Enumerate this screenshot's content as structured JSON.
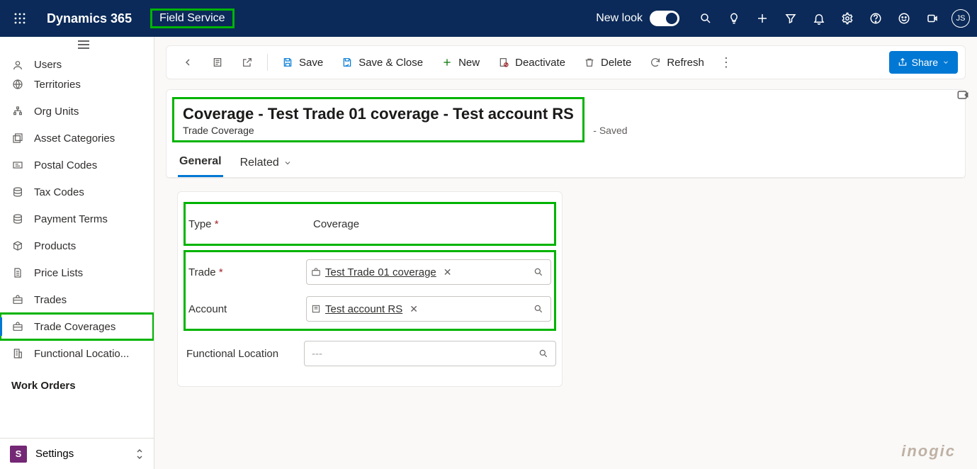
{
  "header": {
    "product": "Dynamics 365",
    "app": "Field Service",
    "newlook_label": "New look",
    "avatar_initials": "JS"
  },
  "sidebar": {
    "items": [
      {
        "label": "Users",
        "icon": "user"
      },
      {
        "label": "Territories",
        "icon": "globe"
      },
      {
        "label": "Org Units",
        "icon": "org"
      },
      {
        "label": "Asset Categories",
        "icon": "asset"
      },
      {
        "label": "Postal Codes",
        "icon": "postal"
      },
      {
        "label": "Tax Codes",
        "icon": "stack"
      },
      {
        "label": "Payment Terms",
        "icon": "stack"
      },
      {
        "label": "Products",
        "icon": "box"
      },
      {
        "label": "Price Lists",
        "icon": "doc"
      },
      {
        "label": "Trades",
        "icon": "toolbox"
      },
      {
        "label": "Trade Coverages",
        "icon": "toolbox",
        "active": true
      },
      {
        "label": "Functional Locatio...",
        "icon": "building"
      }
    ],
    "group_header": "Work Orders",
    "area": {
      "initial": "S",
      "label": "Settings"
    }
  },
  "commands": {
    "save": "Save",
    "save_close": "Save & Close",
    "new": "New",
    "deactivate": "Deactivate",
    "delete": "Delete",
    "refresh": "Refresh",
    "share": "Share"
  },
  "form": {
    "title": "Coverage - Test Trade 01 coverage - Test account RS",
    "status": "- Saved",
    "entity": "Trade Coverage",
    "tabs": {
      "general": "General",
      "related": "Related"
    },
    "fields": {
      "type_label": "Type",
      "type_value": "Coverage",
      "trade_label": "Trade",
      "trade_value": "Test Trade 01 coverage",
      "account_label": "Account",
      "account_value": "Test account RS",
      "functional_location_label": "Functional Location",
      "functional_location_placeholder": "---"
    }
  },
  "watermark": "inogic"
}
